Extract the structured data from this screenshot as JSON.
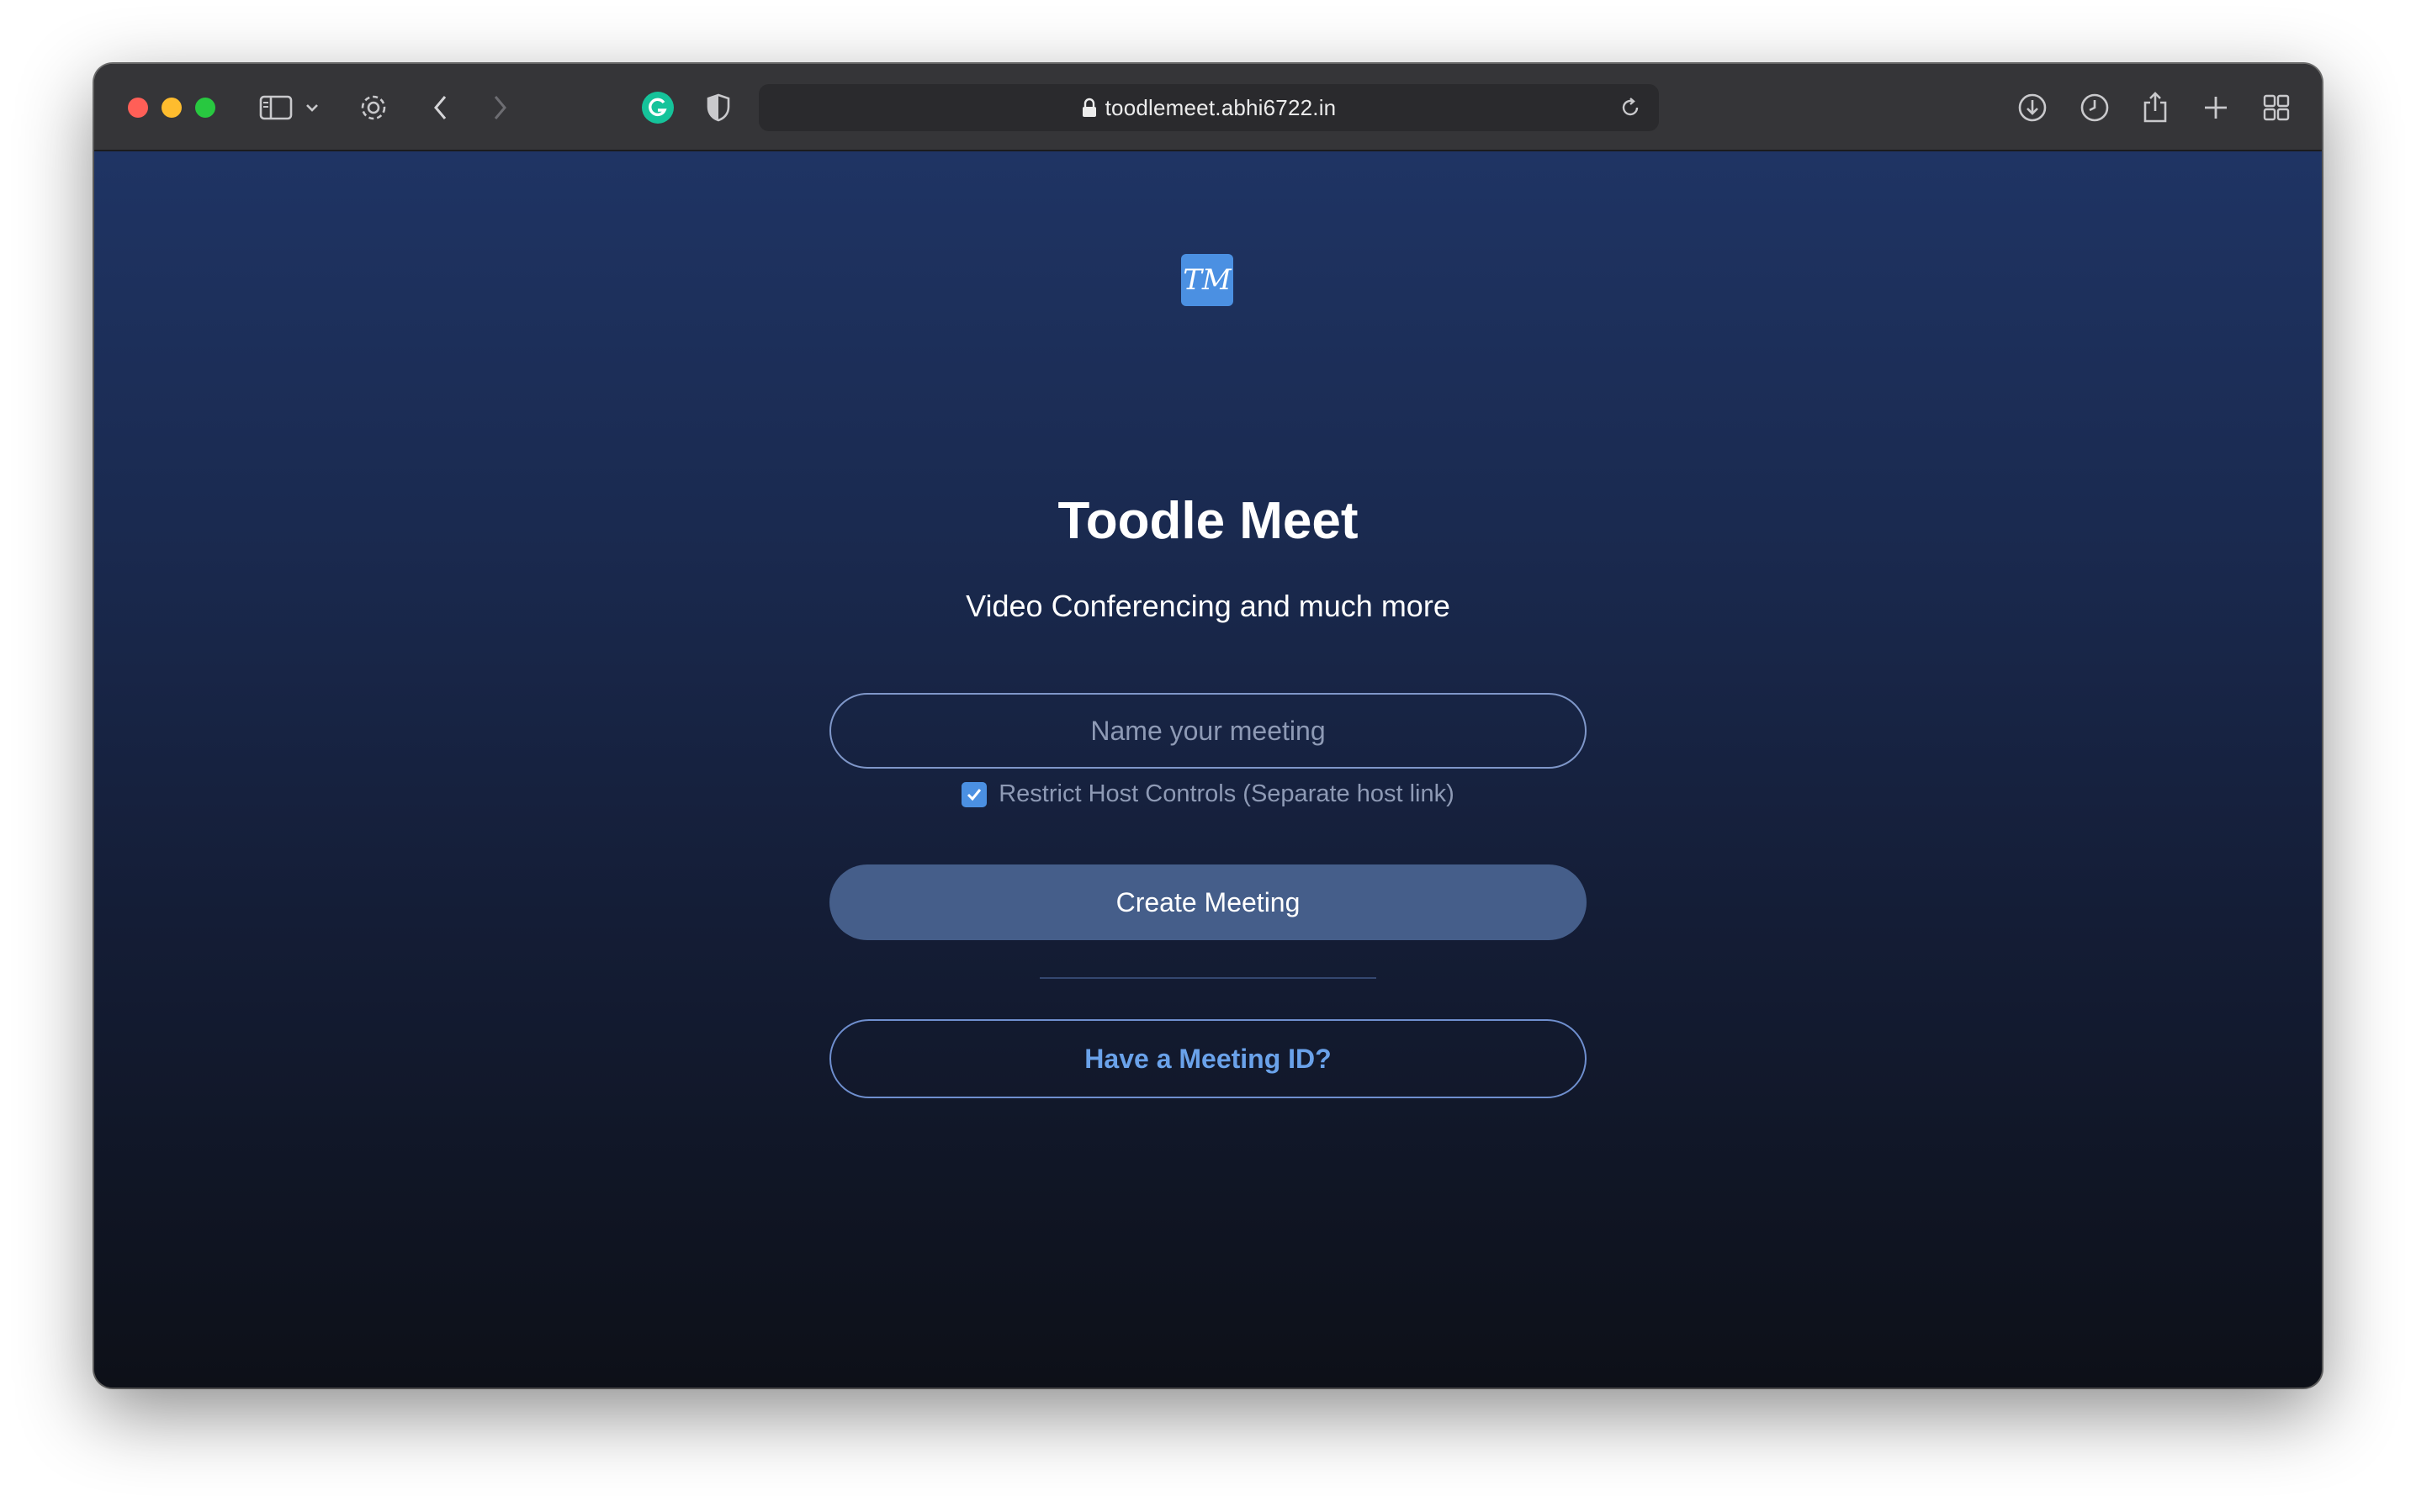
{
  "browser": {
    "url": "toodlemeet.abhi6722.in",
    "icons": [
      "sidebar-icon",
      "chevron-down-icon",
      "gear-icon",
      "back-icon",
      "forward-icon",
      "grammarly-icon",
      "shield-icon",
      "lock-icon",
      "reload-icon",
      "download-icon",
      "history-icon",
      "share-icon",
      "new-tab-icon",
      "tab-overview-icon"
    ]
  },
  "app": {
    "logo_text": "TM",
    "title": "Toodle Meet",
    "subtitle": "Video Conferencing and much more",
    "meeting_name_placeholder": "Name your meeting",
    "meeting_name_value": "",
    "restrict_label": "Restrict Host Controls (Separate host link)",
    "restrict_checked": true,
    "create_button": "Create Meeting",
    "join_button": "Have a Meeting ID?"
  },
  "colors": {
    "accent": "#4b90e2",
    "button_fill": "#455e8a",
    "link": "#6aa2ea",
    "bg_top": "#1f3464",
    "bg_bottom": "#0d1018"
  }
}
